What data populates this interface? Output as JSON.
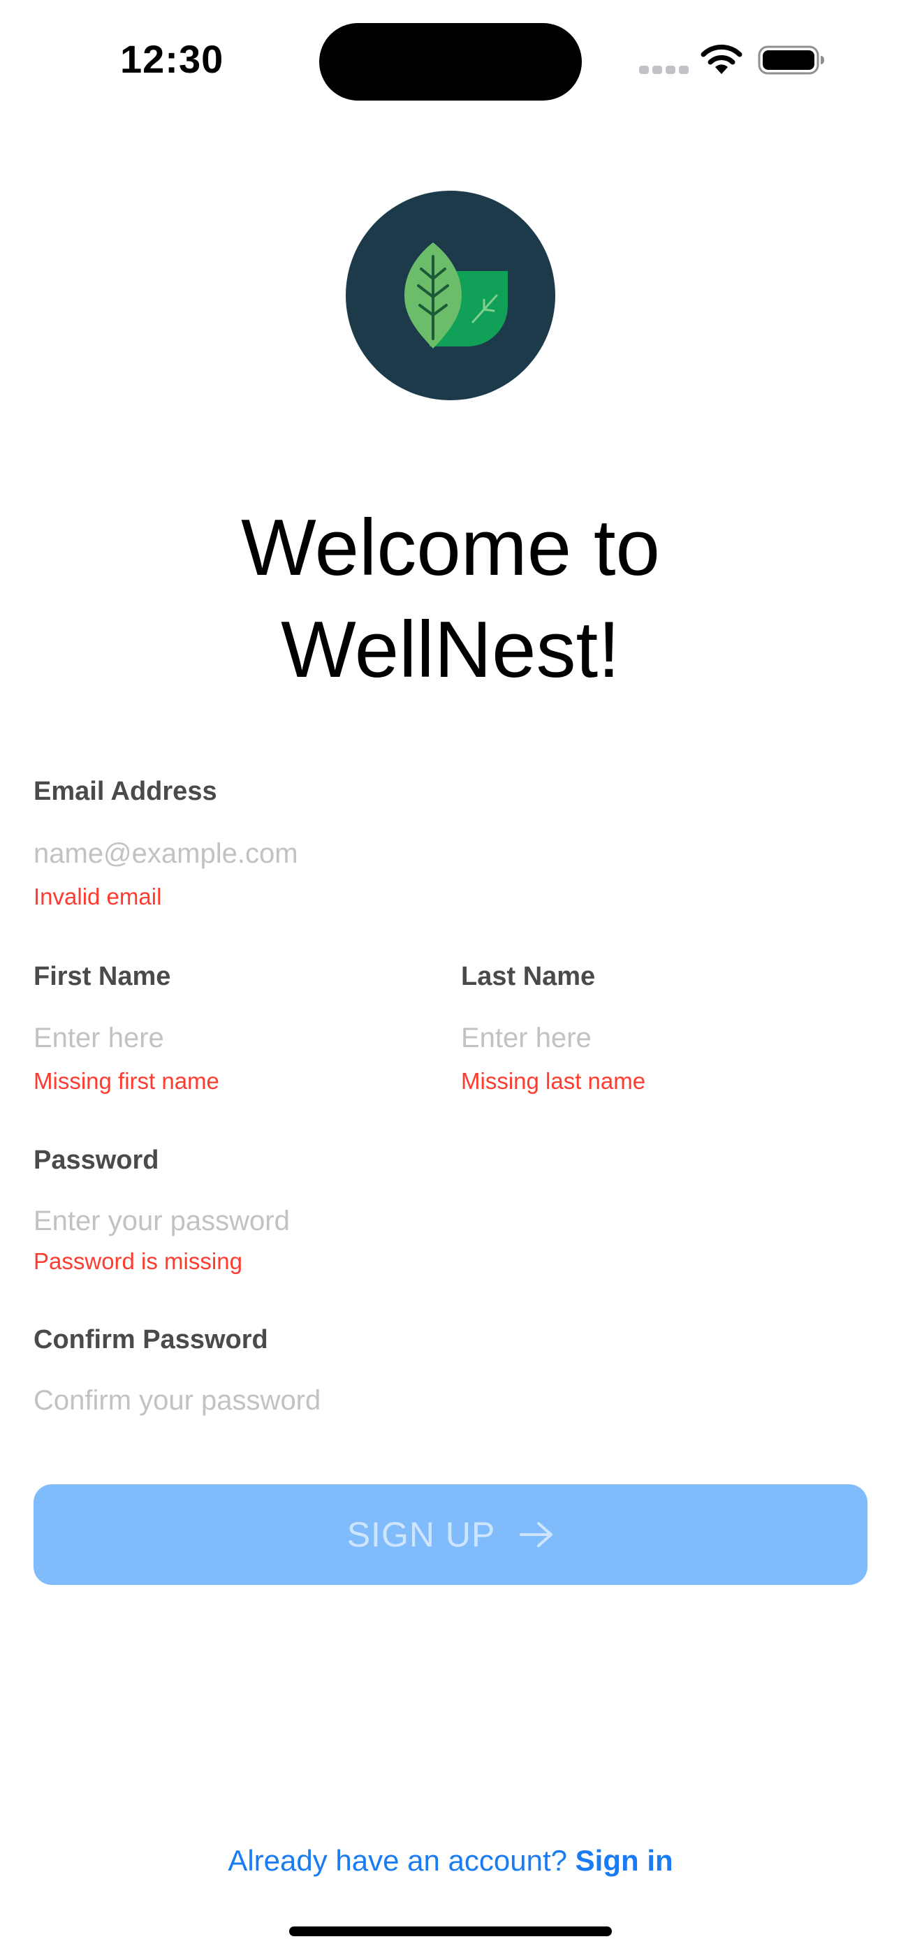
{
  "status_bar": {
    "time": "12:30"
  },
  "logo": {
    "icon": "leaf-logo-icon",
    "circle_color": "#1d3a4b",
    "leaf_light_color": "#6bbd6a",
    "leaf_dark_color": "#10a057"
  },
  "title": {
    "line1": "Welcome to",
    "line2": "WellNest!"
  },
  "form": {
    "email": {
      "label": "Email Address",
      "value": "",
      "placeholder": "name@example.com",
      "error": "Invalid email"
    },
    "first_name": {
      "label": "First Name",
      "value": "",
      "placeholder": "Enter here",
      "error": "Missing first name"
    },
    "last_name": {
      "label": "Last Name",
      "value": "",
      "placeholder": "Enter here",
      "error": "Missing last name"
    },
    "password": {
      "label": "Password",
      "value": "",
      "placeholder": "Enter your password",
      "error": "Password is missing"
    },
    "confirm_password": {
      "label": "Confirm Password",
      "value": "",
      "placeholder": "Confirm your password"
    },
    "submit": {
      "label": "SIGN UP",
      "icon": "arrow-right-icon",
      "enabled": false,
      "color": "#80bcfb"
    }
  },
  "footer": {
    "prompt": "Already have an account?",
    "link": "Sign in",
    "link_color": "#1a7cf2"
  },
  "colors": {
    "error": "#ff3b30",
    "label": "#4a4a4a",
    "placeholder": "#c2c2c4"
  }
}
